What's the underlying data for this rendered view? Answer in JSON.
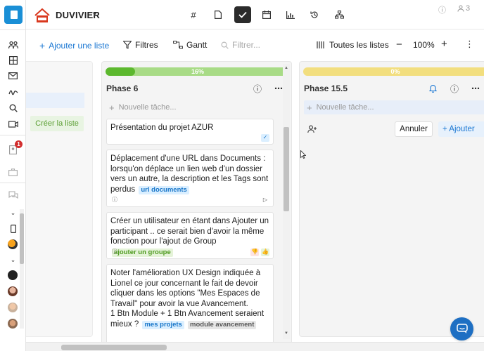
{
  "header": {
    "brand_name": "DUVIVIER",
    "notifications_count": "3"
  },
  "rail": {
    "badge_count": "1"
  },
  "toolbar": {
    "add_list": "Ajouter une liste",
    "filters": "Filtres",
    "gantt": "Gantt",
    "search_placeholder": "Filtrer...",
    "all_lists": "Toutes les listes",
    "zoom": "100%"
  },
  "prev_column": {
    "create_list": "Créer la liste"
  },
  "columns": [
    {
      "title": "Phase 6",
      "progress": 0.16,
      "progress_label": "16%",
      "progress_color": "#5cb82e",
      "track_color": "#a8db86",
      "new_task_placeholder": "Nouvelle tâche...",
      "cards": [
        {
          "text": "Présentation du projet AZUR",
          "tags": []
        },
        {
          "text": "Déplacement d'une URL dans Documents : lorsqu'on déplace un lien web d'un dossier vers un autre, la description et les Tags sont perdus",
          "tags": [
            {
              "label": "url documents",
              "color": "blue"
            }
          ]
        },
        {
          "text": "Créer un utilisateur en étant dans Ajouter un participant .. ce serait bien d'avoir la même fonction pour l'ajout de Group",
          "tags": [
            {
              "label": "ajouter un groupe",
              "color": "green"
            }
          ]
        },
        {
          "text": "Noter l'amélioration UX Design indiquée à Lionel ce jour concernant le fait de devoir cliquer dans les options \"Mes Espaces de Travail\" pour avoir la vue Avancement.\n1 Btn Module + 1 Btn Avancement seraient mieux ?",
          "tags": [
            {
              "label": "mes projets",
              "color": "blue"
            },
            {
              "label": "module avancement",
              "color": "grey"
            }
          ]
        }
      ]
    },
    {
      "title": "Phase 15.5",
      "progress": 0.0,
      "progress_label": "0%",
      "progress_color": "#e8cf5c",
      "track_color": "#f2de7e",
      "new_task_placeholder": "Nouvelle tâche...",
      "cancel_label": "Annuler",
      "add_label": "+ Ajouter"
    }
  ],
  "colors": {
    "accent": "#1976d2",
    "active_view_bg": "#2b2b2b"
  }
}
